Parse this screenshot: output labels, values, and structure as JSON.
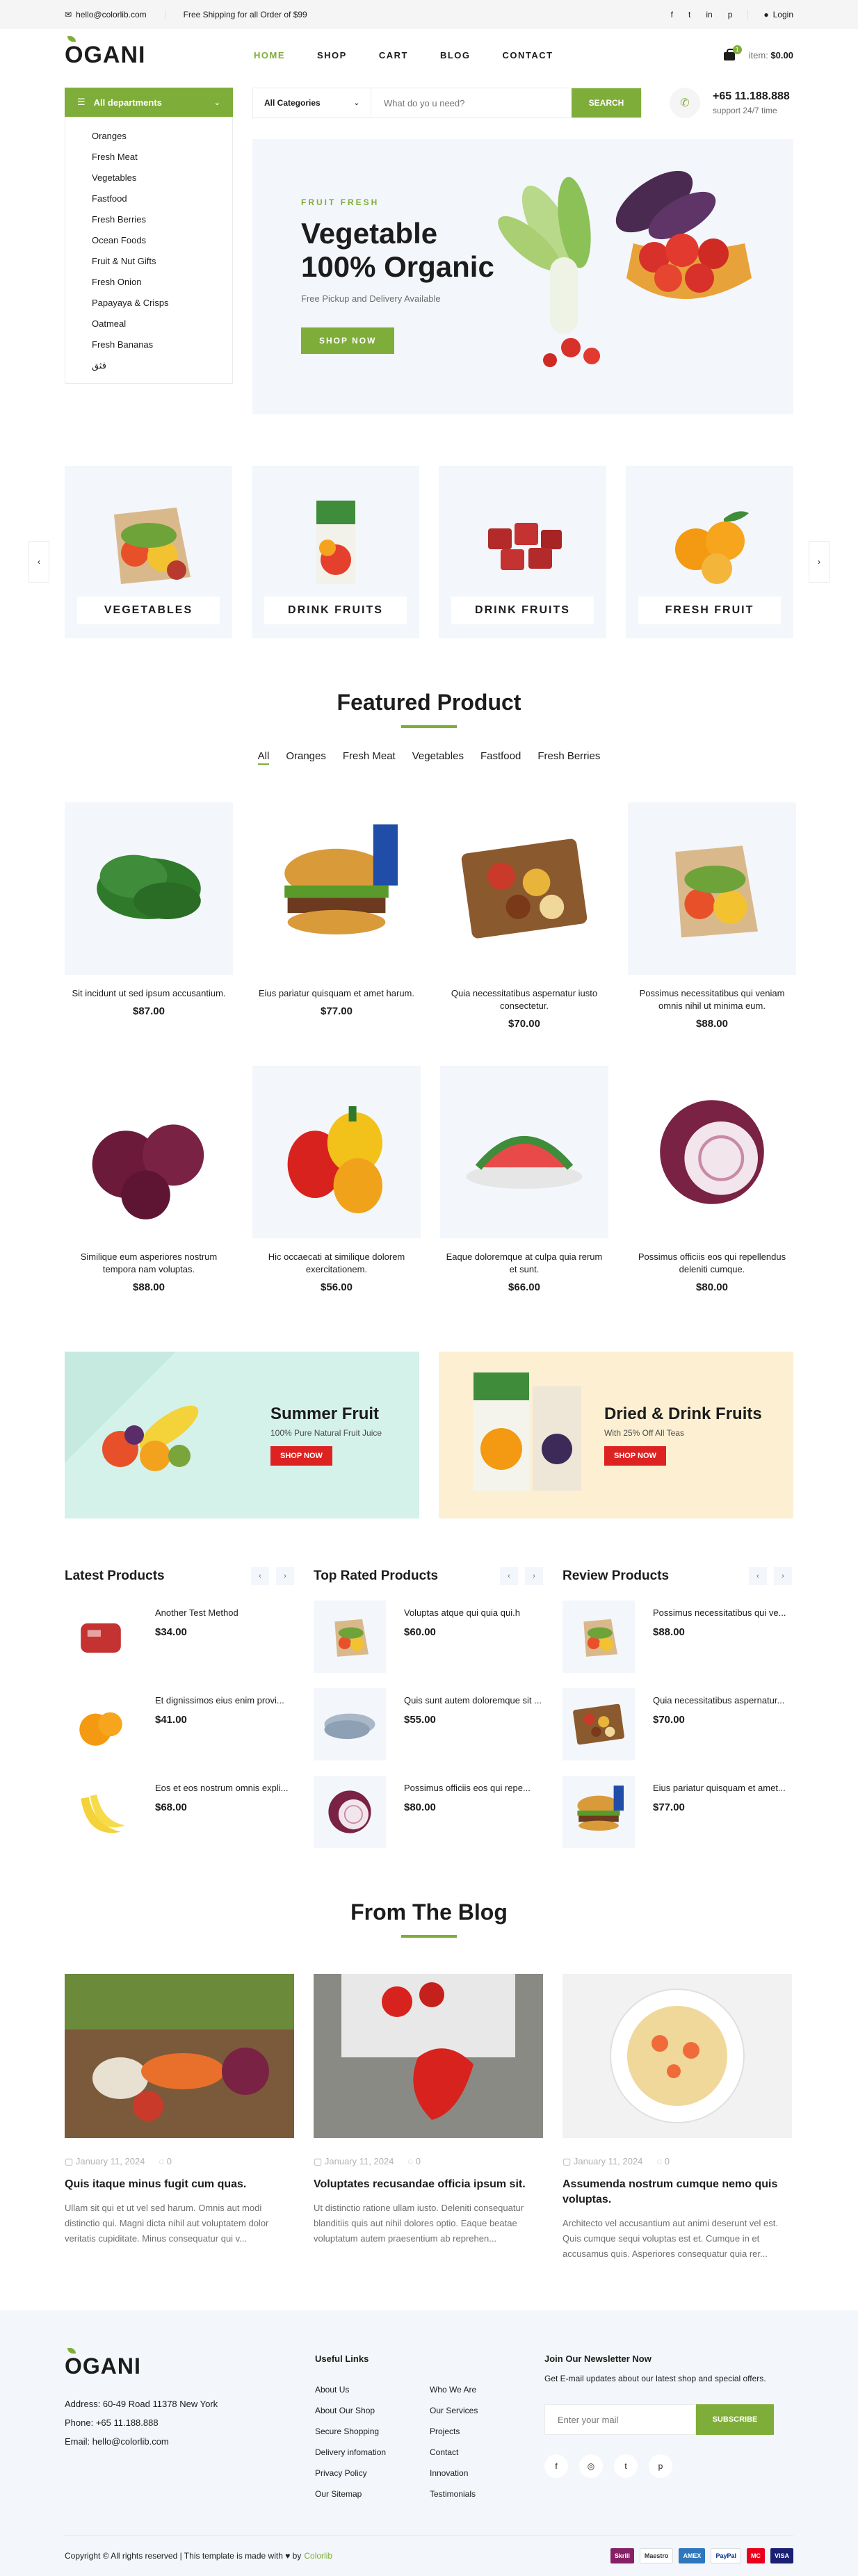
{
  "topbar": {
    "email": "hello@colorlib.com",
    "shipping": "Free Shipping for all Order of $99",
    "social": [
      "f",
      "t",
      "in",
      "p"
    ],
    "login": "Login"
  },
  "header": {
    "logo": "OGANI",
    "nav": [
      "HOME",
      "SHOP",
      "CART",
      "BLOG",
      "CONTACT"
    ],
    "cart_count": "1",
    "item_label": "item:",
    "item_total": "$0.00"
  },
  "departments": {
    "title": "All departments",
    "items": [
      "Oranges",
      "Fresh Meat",
      "Vegetables",
      "Fastfood",
      "Fresh Berries",
      "Ocean Foods",
      "Fruit & Nut Gifts",
      "Fresh Onion",
      "Papayaya & Crisps",
      "Oatmeal",
      "Fresh Bananas",
      "فثق"
    ]
  },
  "search": {
    "category": "All Categories",
    "placeholder": "What do yo u need?",
    "button": "SEARCH"
  },
  "phone": {
    "number": "+65 11.188.888",
    "support": "support 24/7 time"
  },
  "banner": {
    "tag": "FRUIT FRESH",
    "line1": "Vegetable",
    "line2": "100% Organic",
    "subtitle": "Free Pickup and Delivery Available",
    "button": "SHOP NOW"
  },
  "categories": [
    "VEGETABLES",
    "DRINK FRUITS",
    "DRINK FRUITS",
    "FRESH FRUIT"
  ],
  "featured": {
    "title": "Featured Product",
    "filters": [
      "All",
      "Oranges",
      "Fresh Meat",
      "Vegetables",
      "Fastfood",
      "Fresh Berries"
    ],
    "products": [
      {
        "name": "Sit incidunt ut sed ipsum accusantium.",
        "price": "$87.00",
        "kind": "spinach"
      },
      {
        "name": "Eius pariatur quisquam et amet harum.",
        "price": "$77.00",
        "kind": "burger"
      },
      {
        "name": "Quia necessitatibus aspernatur iusto consectetur.",
        "price": "$70.00",
        "kind": "nuts"
      },
      {
        "name": "Possimus necessitatibus qui veniam omnis nihil ut minima eum.",
        "price": "$88.00",
        "kind": "bag"
      },
      {
        "name": "Similique eum asperiores nostrum tempora nam voluptas.",
        "price": "$88.00",
        "kind": "onions"
      },
      {
        "name": "Hic occaecati at similique dolorem exercitationem.",
        "price": "$56.00",
        "kind": "peppers"
      },
      {
        "name": "Eaque doloremque at culpa quia rerum et sunt.",
        "price": "$66.00",
        "kind": "watermelon"
      },
      {
        "name": "Possimus officiis eos qui repellendus deleniti cumque.",
        "price": "$80.00",
        "kind": "onion"
      }
    ]
  },
  "promos": [
    {
      "title": "Summer Fruit",
      "subtitle": "100% Pure Natural Fruit Juice",
      "button": "SHOP NOW"
    },
    {
      "title": "Dried & Drink Fruits",
      "subtitle": "With 25% Off All Teas",
      "button": "SHOP NOW"
    }
  ],
  "lists": [
    {
      "title": "Latest Products",
      "items": [
        {
          "name": "Another Test Method",
          "price": "$34.00"
        },
        {
          "name": "Et dignissimos eius enim provi...",
          "price": "$41.00"
        },
        {
          "name": "Eos et eos nostrum omnis expli...",
          "price": "$68.00"
        }
      ]
    },
    {
      "title": "Top Rated Products",
      "items": [
        {
          "name": "Voluptas atque qui quia qui.h",
          "price": "$60.00"
        },
        {
          "name": "Quis sunt autem doloremque sit ...",
          "price": "$55.00"
        },
        {
          "name": "Possimus officiis eos qui repe...",
          "price": "$80.00"
        }
      ]
    },
    {
      "title": "Review Products",
      "items": [
        {
          "name": "Possimus necessitatibus qui ve...",
          "price": "$88.00"
        },
        {
          "name": "Quia necessitatibus aspernatur...",
          "price": "$70.00"
        },
        {
          "name": "Eius pariatur quisquam et amet...",
          "price": "$77.00"
        }
      ]
    }
  ],
  "blog": {
    "title": "From The Blog",
    "posts": [
      {
        "date": "January 11, 2024",
        "comments": "0",
        "title": "Quis itaque minus fugit cum quas.",
        "text": "Ullam sit qui et ut vel sed harum. Omnis aut modi distinctio qui. Magni dicta nihil aut voluptatem dolor veritatis cupiditate. Minus consequatur qui v..."
      },
      {
        "date": "January 11, 2024",
        "comments": "0",
        "title": "Voluptates recusandae officia ipsum sit.",
        "text": "Ut distinctio ratione ullam iusto. Deleniti consequatur blanditiis quis aut nihil dolores optio. Eaque beatae voluptatum autem praesentium ab reprehen..."
      },
      {
        "date": "January 11, 2024",
        "comments": "0",
        "title": "Assumenda nostrum cumque nemo quis voluptas.",
        "text": "Architecto vel accusantium aut animi deserunt vel est. Quis cumque sequi voluptas est et. Cumque in et accusamus quis. Asperiores consequatur quia rer..."
      }
    ]
  },
  "footer": {
    "logo": "OGANI",
    "address": "Address: 60-49 Road 11378 New York",
    "phone": "Phone: +65 11.188.888",
    "email": "Email: hello@colorlib.com",
    "links_title": "Useful Links",
    "links_col1": [
      "About Us",
      "About Our Shop",
      "Secure Shopping",
      "Delivery infomation",
      "Privacy Policy",
      "Our Sitemap"
    ],
    "links_col2": [
      "Who We Are",
      "Our Services",
      "Projects",
      "Contact",
      "Innovation",
      "Testimonials"
    ],
    "newsletter_title": "Join Our Newsletter Now",
    "newsletter_sub": "Get E-mail updates about our latest shop and special offers.",
    "newsletter_placeholder": "Enter your mail",
    "newsletter_button": "SUBSCRIBE",
    "social": [
      "f",
      "◎",
      "t",
      "p"
    ],
    "copyright": "Copyright © All rights reserved | This template is made with",
    "by": "by",
    "brand": "Colorlib",
    "payments": [
      "Skrill",
      "Maestro",
      "AMEX",
      "PayPal",
      "MC",
      "VISA"
    ]
  },
  "colors": {
    "accent": "#7fad39",
    "red": "#dd2222",
    "bg_light": "#f3f6fa"
  }
}
